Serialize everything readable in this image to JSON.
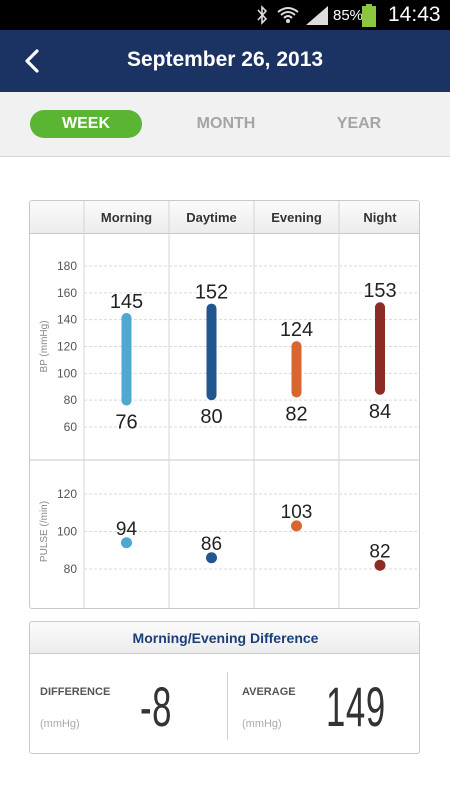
{
  "status_bar": {
    "battery_percent": "85%",
    "time": "14:43",
    "icons": [
      "bluetooth-icon",
      "wifi-icon",
      "signal-icon",
      "battery-icon"
    ]
  },
  "header": {
    "title": "September 26, 2013",
    "back_icon": "chevron-left-icon"
  },
  "tabs": [
    {
      "label": "WEEK",
      "active": true
    },
    {
      "label": "MONTH",
      "active": false
    },
    {
      "label": "YEAR",
      "active": false
    }
  ],
  "colors": {
    "header_bg": "#1b3363",
    "active_tab": "#5ab532",
    "morning": "#4ea8d1",
    "daytime": "#22568f",
    "evening": "#d9662e",
    "night": "#8c2a24"
  },
  "chart_data": [
    {
      "type": "bar",
      "title": "",
      "ylabel": "BP (mmHg)",
      "ylim": [
        60,
        180
      ],
      "yticks": [
        180,
        160,
        140,
        120,
        100,
        80,
        60
      ],
      "categories": [
        "Morning",
        "Daytime",
        "Evening",
        "Night"
      ],
      "series": [
        {
          "category": "Morning",
          "high": 145,
          "low": 76
        },
        {
          "category": "Daytime",
          "high": 152,
          "low": 80
        },
        {
          "category": "Evening",
          "high": 124,
          "low": 82
        },
        {
          "category": "Night",
          "high": 153,
          "low": 84
        }
      ]
    },
    {
      "type": "scatter",
      "title": "",
      "ylabel": "PULSE (/min)",
      "ylim": [
        70,
        120
      ],
      "yticks": [
        120,
        100,
        80
      ],
      "categories": [
        "Morning",
        "Daytime",
        "Evening",
        "Night"
      ],
      "values": [
        94,
        86,
        103,
        82
      ]
    }
  ],
  "difference_panel": {
    "title": "Morning/Evening Difference",
    "difference_label": "DIFFERENCE",
    "difference_unit": "(mmHg)",
    "difference_value": "-8",
    "average_label": "AVERAGE",
    "average_unit": "(mmHg)",
    "average_value": "149"
  }
}
